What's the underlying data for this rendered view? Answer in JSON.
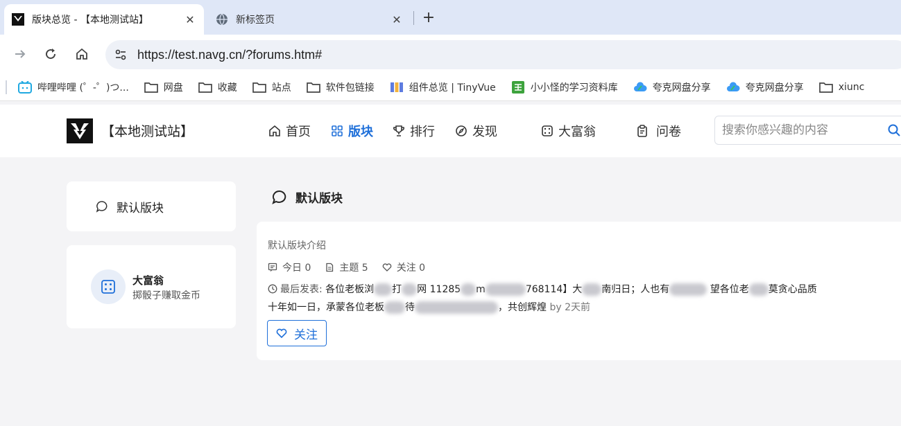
{
  "browser": {
    "tabs": [
      {
        "title": "版块总览 - 【本地测试站】",
        "active": true
      },
      {
        "title": "新标签页",
        "active": false
      }
    ],
    "url": "https://test.navg.cn/?forums.htm#",
    "bookmarks": [
      {
        "label": "哔哩哔哩 (゜-゜)つ...",
        "icon": "bilibili-icon"
      },
      {
        "label": "网盘",
        "icon": "folder-icon"
      },
      {
        "label": "收藏",
        "icon": "folder-icon"
      },
      {
        "label": "站点",
        "icon": "folder-icon"
      },
      {
        "label": "软件包链接",
        "icon": "folder-icon"
      },
      {
        "label": "组件总览 | TinyVue",
        "icon": "tinyvue-icon"
      },
      {
        "label": "小小怪的学习资料库",
        "icon": "sheet-icon"
      },
      {
        "label": "夸克网盘分享",
        "icon": "quark-cloud-icon"
      },
      {
        "label": "夸克网盘分享",
        "icon": "quark-cloud-icon"
      },
      {
        "label": "xiunc",
        "icon": "folder-icon"
      }
    ]
  },
  "site": {
    "name": "【本地测试站】",
    "nav": [
      {
        "label": "首页",
        "icon": "home-icon",
        "active": false
      },
      {
        "label": "版块",
        "icon": "grid-icon",
        "active": true
      },
      {
        "label": "排行",
        "icon": "trophy-icon",
        "active": false
      },
      {
        "label": "发现",
        "icon": "compass-icon",
        "active": false
      },
      {
        "label": "大富翁",
        "icon": "dice-icon",
        "active": false
      },
      {
        "label": "问卷",
        "icon": "clipboard-icon",
        "active": false
      }
    ],
    "search_placeholder": "搜索你感兴趣的内容"
  },
  "sidebar": {
    "forum_label": "默认版块",
    "game": {
      "name": "大富翁",
      "desc": "掷骰子赚取金币"
    }
  },
  "main": {
    "title": "默认版块",
    "intro": "默认版块介绍",
    "stats": {
      "today": "今日 0",
      "topics": "主题 5",
      "follows": "关注 0"
    },
    "last_post": {
      "label": "最后发表:",
      "text_a": "各位老板浏",
      "text_b": "打",
      "text_c": "网",
      "text_d": "11285",
      "text_e": "m",
      "text_f": "768114】大",
      "text_g": "南归日；人也有",
      "text_h": "望各位老",
      "text_i": "莫贪心品质",
      "text_j": "十年如一日，承蒙各位老板",
      "text_k": "待",
      "text_l": "，共创辉煌",
      "by": "by 2天前"
    },
    "follow_label": "关注"
  },
  "colors": {
    "accent": "#1e6fd9",
    "page_bg": "#f4f4f6"
  }
}
